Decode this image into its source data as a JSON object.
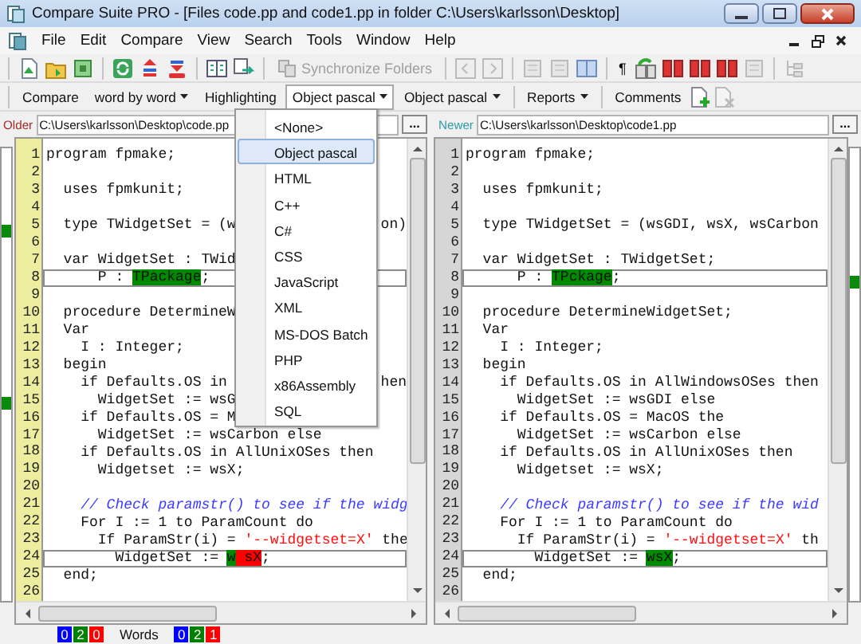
{
  "window": {
    "title": "Compare Suite PRO - [Files code.pp and code1.pp in folder C:\\Users\\karlsson\\Desktop]"
  },
  "menu": [
    "File",
    "Edit",
    "Compare",
    "View",
    "Search",
    "Tools",
    "Window",
    "Help"
  ],
  "toolbar": {
    "sync_button": {
      "label": "Synchronize Folders",
      "disabled": true
    },
    "pilcrow": "¶"
  },
  "options_bar": [
    {
      "label": "Compare",
      "kind": "label",
      "pressed": false
    },
    {
      "label": "word by word",
      "kind": "dropdown",
      "pressed": false
    },
    {
      "label": "Highlighting",
      "kind": "label",
      "pressed": false
    },
    {
      "label": "Object pascal",
      "kind": "dropdown",
      "pressed": true
    },
    {
      "label": "Object pascal",
      "kind": "dropdown",
      "pressed": false
    },
    {
      "label": "Reports",
      "kind": "dropdown",
      "pressed": false
    },
    {
      "label": "Comments",
      "kind": "label",
      "pressed": false
    }
  ],
  "language_menu": {
    "items": [
      {
        "label": "<None>",
        "selected": false
      },
      {
        "label": "Object pascal",
        "selected": true
      },
      {
        "label": "HTML",
        "selected": false
      },
      {
        "label": "C++",
        "selected": false
      },
      {
        "label": "C#",
        "selected": false
      },
      {
        "label": "CSS",
        "selected": false
      },
      {
        "label": "JavaScript",
        "selected": false
      },
      {
        "label": "XML",
        "selected": false
      },
      {
        "label": "MS-DOS Batch",
        "selected": false
      },
      {
        "label": "PHP",
        "selected": false
      },
      {
        "label": "x86Assembly",
        "selected": false
      },
      {
        "label": "SQL",
        "selected": false
      }
    ]
  },
  "panes": [
    {
      "label": "Older",
      "color": "#a52a2a",
      "path": "C:\\Users\\karlsson\\Desktop\\code.pp",
      "browse": "...",
      "active": true,
      "lines": [
        {
          "number": "1",
          "text": "program fpmake;",
          "boxed": false
        },
        {
          "number": "2",
          "boxed": false
        },
        {
          "number": "3",
          "text": "  uses fpmkunit;",
          "boxed": false
        },
        {
          "number": "4",
          "boxed": false
        },
        {
          "number": "5",
          "text": "  type TWidgetSet = (w",
          "tail": "on)",
          "boxed": false
        },
        {
          "number": "6",
          "boxed": false
        },
        {
          "number": "7",
          "text": "  var WidgetSet : TWid",
          "boxed": false
        },
        {
          "number": "8",
          "segments": [
            {
              "text": "      P : ",
              "kind": "plain"
            },
            {
              "text": "TPackage",
              "kind": "added"
            },
            {
              "text": ";",
              "kind": "plain"
            }
          ],
          "boxed": true
        },
        {
          "number": "9",
          "boxed": false
        },
        {
          "number": "10",
          "text": "  procedure DetermineW",
          "boxed": false
        },
        {
          "number": "11",
          "text": "  Var",
          "boxed": false
        },
        {
          "number": "12",
          "text": "    I : Integer;",
          "boxed": false
        },
        {
          "number": "13",
          "text": "  begin",
          "boxed": false
        },
        {
          "number": "14",
          "text": "    if Defaults.OS in",
          "tail": "hen",
          "boxed": false
        },
        {
          "number": "15",
          "text": "      WidgetSet := wsG",
          "boxed": false
        },
        {
          "number": "16",
          "text": "    if Defaults.OS = M",
          "boxed": false
        },
        {
          "number": "17",
          "text": "      WidgetSet := wsCarbon else",
          "boxed": false
        },
        {
          "number": "18",
          "text": "    if Defaults.OS in AllUnixOSes then",
          "boxed": false
        },
        {
          "number": "19",
          "text": "      Widgetset := wsX;",
          "boxed": false
        },
        {
          "number": "20",
          "boxed": false
        },
        {
          "number": "21",
          "segments": [
            {
              "text": "    // Check paramstr() to see if the widg",
              "kind": "comment"
            }
          ],
          "boxed": false
        },
        {
          "number": "22",
          "text": "    For I := 1 to ParamCount do",
          "boxed": false
        },
        {
          "number": "23",
          "segments": [
            {
              "text": "      If ParamStr(i) = ",
              "kind": "plain"
            },
            {
              "text": "'--widgetset=X'",
              "kind": "string"
            },
            {
              "text": " the",
              "kind": "plain"
            }
          ],
          "boxed": false
        },
        {
          "number": "24",
          "segments": [
            {
              "text": "        WidgetSet := ",
              "kind": "plain"
            },
            {
              "text": "w",
              "kind": "added"
            },
            {
              "text": " sX",
              "kind": "removed"
            },
            {
              "text": ";",
              "kind": "plain"
            }
          ],
          "boxed": true
        },
        {
          "number": "25",
          "text": "  end;",
          "boxed": false
        },
        {
          "number": "26",
          "boxed": false
        }
      ]
    },
    {
      "label": "Newer",
      "color": "#2e9aa6",
      "path": "C:\\Users\\karlsson\\Desktop\\code1.pp",
      "browse": "...",
      "active": false,
      "lines": [
        {
          "number": "1",
          "text": "program fpmake;",
          "boxed": false
        },
        {
          "number": "2",
          "boxed": false
        },
        {
          "number": "3",
          "text": "  uses fpmkunit;",
          "boxed": false
        },
        {
          "number": "4",
          "boxed": false
        },
        {
          "number": "5",
          "text": "  type TWidgetSet = (wsGDI, wsX, wsCarbon",
          "boxed": false
        },
        {
          "number": "6",
          "boxed": false
        },
        {
          "number": "7",
          "text": "  var WidgetSet : TWidgetSet;",
          "boxed": false
        },
        {
          "number": "8",
          "segments": [
            {
              "text": "      P : ",
              "kind": "plain"
            },
            {
              "text": "TPckage",
              "kind": "added"
            },
            {
              "text": ";",
              "kind": "plain"
            }
          ],
          "boxed": true
        },
        {
          "number": "9",
          "boxed": false
        },
        {
          "number": "10",
          "text": "  procedure DetermineWidgetSet;",
          "boxed": false
        },
        {
          "number": "11",
          "text": "  Var",
          "boxed": false
        },
        {
          "number": "12",
          "text": "    I : Integer;",
          "boxed": false
        },
        {
          "number": "13",
          "text": "  begin",
          "boxed": false
        },
        {
          "number": "14",
          "text": "    if Defaults.OS in AllWindowsOSes then",
          "boxed": false
        },
        {
          "number": "15",
          "text": "      WidgetSet := wsGDI else",
          "boxed": false
        },
        {
          "number": "16",
          "text": "    if Defaults.OS = MacOS the",
          "boxed": false
        },
        {
          "number": "17",
          "text": "      WidgetSet := wsCarbon else",
          "boxed": false
        },
        {
          "number": "18",
          "text": "    if Defaults.OS in AllUnixOSes then",
          "boxed": false
        },
        {
          "number": "19",
          "text": "      Widgetset := wsX;",
          "boxed": false
        },
        {
          "number": "20",
          "boxed": false
        },
        {
          "number": "21",
          "segments": [
            {
              "text": "    // Check paramstr() to see if the wid",
              "kind": "comment"
            }
          ],
          "boxed": false
        },
        {
          "number": "22",
          "text": "    For I := 1 to ParamCount do",
          "boxed": false
        },
        {
          "number": "23",
          "segments": [
            {
              "text": "      If ParamStr(i) = ",
              "kind": "plain"
            },
            {
              "text": "'--widgetset=X'",
              "kind": "string"
            },
            {
              "text": " th",
              "kind": "plain"
            }
          ],
          "boxed": false
        },
        {
          "number": "24",
          "segments": [
            {
              "text": "        WidgetSet := ",
              "kind": "plain"
            },
            {
              "text": "wsX",
              "kind": "added"
            },
            {
              "text": ";",
              "kind": "plain"
            }
          ],
          "boxed": true
        },
        {
          "number": "25",
          "text": "  end;",
          "boxed": false
        },
        {
          "number": "26",
          "boxed": false
        }
      ]
    }
  ],
  "status_bar": {
    "line_counts": [
      {
        "text": "0",
        "color": "#0000ff"
      },
      {
        "text": "2",
        "color": "#008000"
      },
      {
        "text": "0",
        "color": "#ff0000"
      }
    ],
    "words_label": "Words",
    "word_counts": [
      {
        "text": "0",
        "color": "#0000ff"
      },
      {
        "text": "2",
        "color": "#008000"
      },
      {
        "text": "1",
        "color": "#ff0000"
      }
    ]
  }
}
